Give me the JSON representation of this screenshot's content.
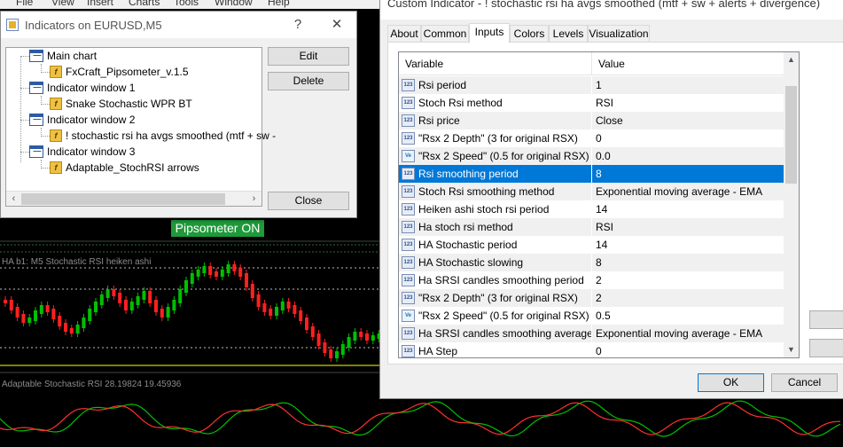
{
  "menubar": {
    "items": [
      "File",
      "View",
      "Insert",
      "Charts",
      "Tools",
      "Window",
      "Help"
    ]
  },
  "chart": {
    "pipsometer_label": "Pipsometer ON",
    "subwindow1_label": "HA b1: M5 Stochastic RSI heiken ashi",
    "subwindow2_label": "Adaptable Stochastic RSI 28.19824 19.45936",
    "colors": {
      "bull": "#00c000",
      "bear": "#ff2020",
      "level": "#ffff00",
      "line_green": "#00c000",
      "line_red": "#ff3030"
    }
  },
  "indicators_dialog": {
    "title": "Indicators on EURUSD,M5",
    "help_btn": "?",
    "close_btn": "✕",
    "tree": [
      {
        "label": "Main chart",
        "type": "window",
        "level": 0
      },
      {
        "label": "FxCraft_Pipsometer_v.1.5",
        "type": "indicator",
        "level": 1
      },
      {
        "label": "Indicator window 1",
        "type": "window",
        "level": 0
      },
      {
        "label": "Snake Stochastic WPR BT",
        "type": "indicator",
        "level": 1
      },
      {
        "label": "Indicator window 2",
        "type": "window",
        "level": 0
      },
      {
        "label": "! stochastic rsi ha avgs smoothed (mtf + sw -",
        "type": "indicator",
        "level": 1
      },
      {
        "label": "Indicator window 3",
        "type": "window",
        "level": 0
      },
      {
        "label": "Adaptable_StochRSI arrows",
        "type": "indicator",
        "level": 1
      }
    ],
    "edit_label": "Edit",
    "delete_label": "Delete",
    "close_label": "Close"
  },
  "custom_indicator_dialog": {
    "title": "Custom Indicator - ! stochastic rsi ha avgs smoothed (mtf + sw + alerts + divergence)",
    "tabs": [
      "About",
      "Common",
      "Inputs",
      "Colors",
      "Levels",
      "Visualization"
    ],
    "active_tab": "Inputs",
    "grid_headers": {
      "variable": "Variable",
      "value": "Value"
    },
    "rows": [
      {
        "icon": "123",
        "variable": "Rsi period",
        "value": "1"
      },
      {
        "icon": "123",
        "variable": "Stoch Rsi method",
        "value": "RSI"
      },
      {
        "icon": "123",
        "variable": "Rsi price",
        "value": "Close"
      },
      {
        "icon": "123",
        "variable": "\"Rsx 2 Depth\" (3 for original RSX)",
        "value": "0"
      },
      {
        "icon": "Ve",
        "variable": "\"Rsx 2 Speed\" (0.5 for original RSX)",
        "value": "0.0"
      },
      {
        "icon": "123",
        "variable": "Rsi smoothing period",
        "value": "8"
      },
      {
        "icon": "123",
        "variable": "Stoch Rsi smoothing method",
        "value": "Exponential moving average - EMA"
      },
      {
        "icon": "123",
        "variable": "Heiken ashi stoch rsi period",
        "value": "14"
      },
      {
        "icon": "123",
        "variable": "Ha stoch rsi method",
        "value": "RSI"
      },
      {
        "icon": "123",
        "variable": "HA Stochastic period",
        "value": "14"
      },
      {
        "icon": "123",
        "variable": "HA Stochastic slowing",
        "value": "8"
      },
      {
        "icon": "123",
        "variable": "Ha SRSI candles smoothing period",
        "value": "2"
      },
      {
        "icon": "123",
        "variable": "\"Rsx 2 Depth\" (3 for original RSX)",
        "value": "2"
      },
      {
        "icon": "Ve",
        "variable": "\"Rsx 2 Speed\" (0.5 for original RSX)",
        "value": "0.5"
      },
      {
        "icon": "123",
        "variable": "Ha SRSI candles smoothing average t...",
        "value": "Exponential moving average - EMA"
      },
      {
        "icon": "123",
        "variable": "HA Step",
        "value": "0"
      }
    ],
    "selected_row": 5,
    "ok_label": "OK",
    "cancel_label": "Cancel"
  }
}
